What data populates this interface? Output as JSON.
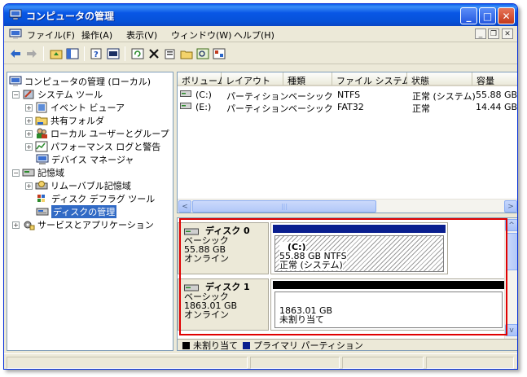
{
  "window": {
    "title": "コンピュータの管理",
    "minimize": "_",
    "maximize": "□",
    "close": "✕"
  },
  "menu": {
    "items": [
      "ファイル(F)",
      "操作(A)",
      "表示(V)",
      "ウィンドウ(W)",
      "ヘルプ(H)"
    ],
    "mdi_minimize": "_",
    "mdi_restore": "❐",
    "mdi_close": "✕"
  },
  "toolbar": {
    "icons": [
      "back-arrow-icon",
      "forward-arrow-icon",
      "up-folder-icon",
      "show-hide-tree-icon",
      "help-icon",
      "console-icon",
      "refresh-icon",
      "delete-icon",
      "properties-icon",
      "open-icon",
      "search-icon",
      "settings-icon"
    ]
  },
  "tree": {
    "root": "コンピュータの管理 (ローカル)",
    "system_tools": "システム ツール",
    "event_viewer": "イベント ビューア",
    "shared_folders": "共有フォルダ",
    "local_users": "ローカル ユーザーとグループ",
    "performance": "パフォーマンス ログと警告",
    "device_manager": "デバイス マネージャ",
    "storage": "記憶域",
    "removable": "リムーバブル記憶域",
    "defrag": "ディスク デフラグ ツール",
    "disk_mgmt": "ディスクの管理",
    "services": "サービスとアプリケーション",
    "expand_plus": "+",
    "expand_minus": "−"
  },
  "volumes": {
    "columns": [
      "ボリューム",
      "レイアウト",
      "種類",
      "ファイル システム",
      "状態",
      "容量"
    ],
    "rows": [
      {
        "volume": "(C:)",
        "layout": "パーティション",
        "type": "ベーシック",
        "fs": "NTFS",
        "status": "正常 (システム)",
        "capacity": "55.88 GB"
      },
      {
        "volume": "(E:)",
        "layout": "パーティション",
        "type": "ベーシック",
        "fs": "FAT32",
        "status": "正常",
        "capacity": "14.44 GB"
      }
    ],
    "scroll_left": "<",
    "scroll_right": ">",
    "scroll_grip": "|||"
  },
  "disks": [
    {
      "name": "ディスク 0",
      "type": "ベーシック",
      "size": "55.88 GB",
      "state": "オンライン",
      "partition": {
        "label": "(C:)",
        "size_fs": "55.88 GB NTFS",
        "status": "正常 (システム)",
        "kind": "primary"
      }
    },
    {
      "name": "ディスク 1",
      "type": "ベーシック",
      "size": "1863.01 GB",
      "state": "オンライン",
      "partition": {
        "label": "",
        "size_fs": "1863.01 GB",
        "status": "未割り当て",
        "kind": "unallocated"
      }
    }
  ],
  "legend": {
    "unallocated": "未割り当て",
    "primary": "プライマリ パーティション",
    "unallocated_color": "#000000",
    "primary_color": "#0a1f8f"
  },
  "disk_scroll": {
    "up": "^",
    "down": "v"
  }
}
